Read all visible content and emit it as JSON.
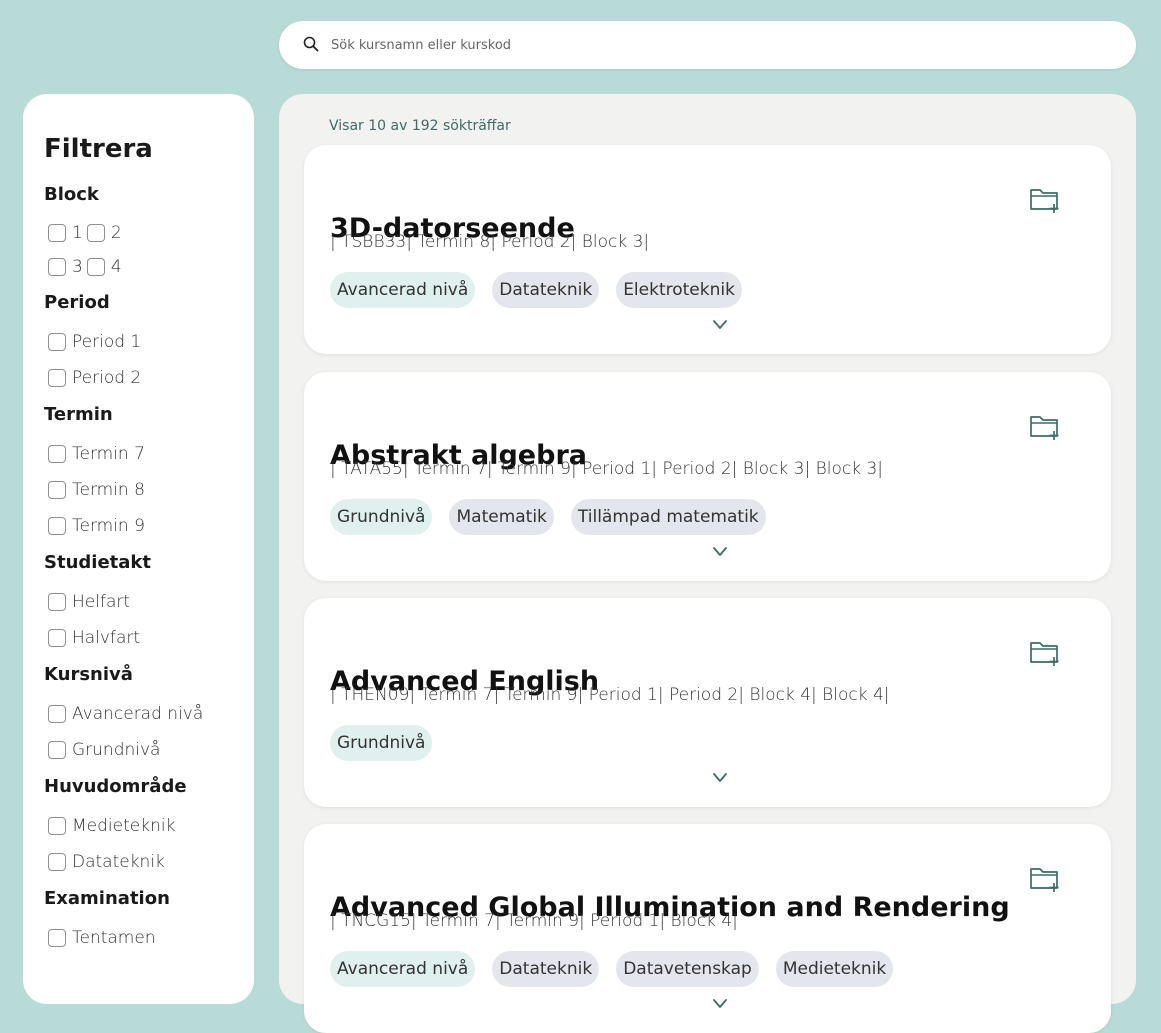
{
  "search": {
    "placeholder": "Sök kursnamn eller kurskod",
    "value": ""
  },
  "filter": {
    "title": "Filtrera",
    "groups": [
      {
        "title": "Block",
        "options": [
          "1",
          "2",
          "3",
          "4"
        ]
      },
      {
        "title": "Period",
        "options": [
          "Period 1",
          "Period 2"
        ]
      },
      {
        "title": "Termin",
        "options": [
          "Termin 7",
          "Termin 8",
          "Termin 9"
        ]
      },
      {
        "title": "Studietakt",
        "options": [
          "Helfart",
          "Halvfart"
        ]
      },
      {
        "title": "Kursnivå",
        "options": [
          "Avancerad nivå",
          "Grundnivå"
        ]
      },
      {
        "title": "Huvudområde",
        "options": [
          "Medieteknik",
          "Datateknik"
        ]
      },
      {
        "title": "Examination",
        "options": [
          "Tentamen"
        ]
      }
    ]
  },
  "results": {
    "count_text": "Visar 10 av 192 sökträffar",
    "courses": [
      {
        "title": "3D-datorseende",
        "meta": "| TSBB33| Termin 8| Period 2| Block 3|",
        "level": "Avancerad nivå",
        "areas": [
          "Datateknik",
          "Elektroteknik"
        ]
      },
      {
        "title": "Abstrakt algebra",
        "meta": "| TATA55| Termin 7| Termin 9| Period 1| Period 2| Block 3| Block 3|",
        "level": "Grundnivå",
        "areas": [
          "Matematik",
          "Tillämpad matematik"
        ]
      },
      {
        "title": "Advanced English",
        "meta": "| THEN09| Termin 7| Termin 9| Period 1| Period 2| Block 4| Block 4|",
        "level": "Grundnivå",
        "areas": []
      },
      {
        "title": "Advanced Global Illumination and Rendering",
        "meta": "| TNCG15| Termin 7| Termin 9| Period 1| Block 4|",
        "level": "Avancerad nivå",
        "areas": [
          "Datateknik",
          "Datavetenskap",
          "Medieteknik"
        ]
      }
    ]
  },
  "icons": {
    "search": "search-icon",
    "add_to_folder": "folder-plus-icon",
    "expand": "chevron-down-icon"
  },
  "colors": {
    "background": "#b9dbd8",
    "accent": "#3d6b67",
    "level_tag": "#dff0ee",
    "area_tag": "#e4e6ee"
  }
}
